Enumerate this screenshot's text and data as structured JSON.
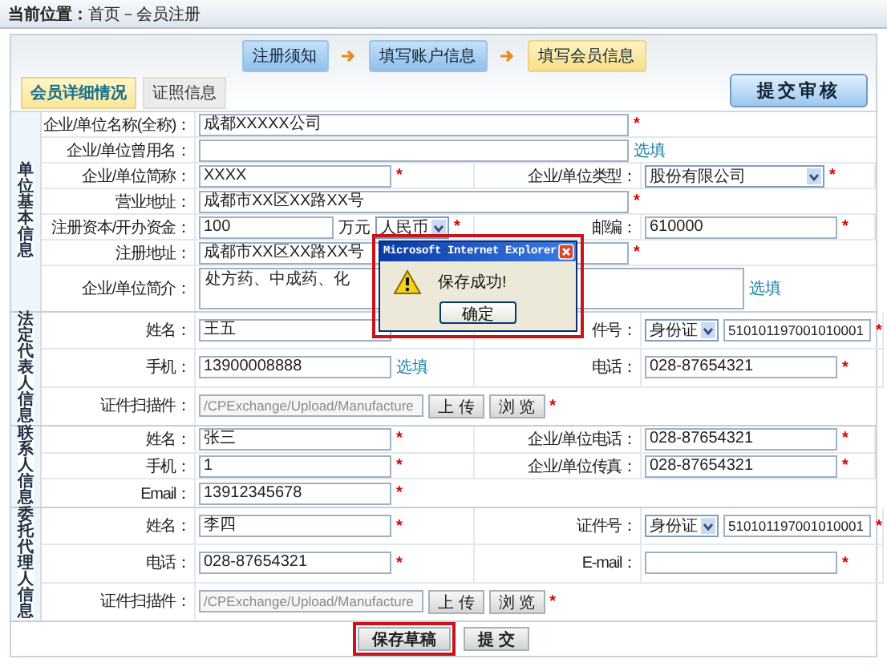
{
  "breadcrumb": {
    "label": "当前位置：",
    "path": "首页－会员注册"
  },
  "steps": [
    {
      "label": "注册须知",
      "selected": false
    },
    {
      "label": "填写账户信息",
      "selected": false
    },
    {
      "label": "填写会员信息",
      "selected": true
    }
  ],
  "tabs": [
    {
      "label": "会员详细情况",
      "selected": true
    },
    {
      "label": "证照信息",
      "selected": false
    }
  ],
  "review_button": {
    "label": "提交审核"
  },
  "sections": [
    {
      "title": "单位基本信息",
      "rows": [
        {
          "groups": [
            {
              "label": "企业/单位名称(全称)：",
              "items": [
                {
                  "kind": "long-input",
                  "value": "成都XXXXX公司"
                },
                {
                  "kind": "required",
                  "text": "*"
                }
              ]
            }
          ]
        },
        {
          "groups": [
            {
              "label": "企业/单位曾用名：",
              "items": [
                {
                  "kind": "long-input"
                },
                {
                  "kind": "optional",
                  "text": "选填"
                }
              ]
            }
          ]
        },
        {
          "groups": [
            {
              "label": "企业/单位简称：",
              "items": [
                {
                  "kind": "input",
                  "value": "XXXX"
                },
                {
                  "kind": "required",
                  "text": "*"
                }
              ]
            },
            {
              "label": "企业/单位类型：",
              "items": [
                {
                  "kind": "wide-select",
                  "value": "股份有限公司"
                },
                {
                  "kind": "required",
                  "text": "*"
                }
              ]
            }
          ]
        },
        {
          "groups": [
            {
              "label": "营业地址：",
              "items": [
                {
                  "kind": "long-input",
                  "value": "成都市XX区XX路XX号"
                },
                {
                  "kind": "required",
                  "text": "*"
                }
              ]
            }
          ]
        },
        {
          "groups": [
            {
              "label": "注册资本/开办资金：",
              "items": [
                {
                  "kind": "short-input",
                  "value": "100"
                },
                {
                  "kind": "unit",
                  "text": "万元"
                },
                {
                  "kind": "select",
                  "value": "人民币"
                },
                {
                  "kind": "required",
                  "text": "*"
                }
              ]
            },
            {
              "label": "邮编：",
              "items": [
                {
                  "kind": "input",
                  "value": "610000"
                },
                {
                  "kind": "required",
                  "text": "*"
                }
              ]
            }
          ]
        },
        {
          "groups": [
            {
              "label": "注册地址：",
              "items": [
                {
                  "kind": "long-input",
                  "value": "成都市XX区XX路XX号"
                },
                {
                  "kind": "required",
                  "text": "*"
                }
              ]
            }
          ]
        },
        {
          "groups": [
            {
              "label": "企业/单位简介：",
              "items": [
                {
                  "kind": "textarea",
                  "value": "处方药、中成药、化"
                },
                {
                  "kind": "optional",
                  "text": "选填"
                }
              ]
            }
          ]
        }
      ]
    },
    {
      "title": "法定代表人信息",
      "rows": [
        {
          "groups": [
            {
              "label": "姓名：",
              "items": [
                {
                  "kind": "input",
                  "value": "王五"
                }
              ]
            },
            {
              "label": "件号：",
              "items": [
                {
                  "kind": "select",
                  "value": "身份证"
                },
                {
                  "kind": "id-input",
                  "value": "510101197001010001"
                },
                {
                  "kind": "required",
                  "text": "*"
                }
              ]
            }
          ]
        },
        {
          "groups": [
            {
              "label": "手机：",
              "items": [
                {
                  "kind": "input",
                  "value": "13900008888"
                },
                {
                  "kind": "optional",
                  "text": "选填"
                }
              ]
            },
            {
              "label": "电话：",
              "items": [
                {
                  "kind": "input",
                  "value": "028-87654321"
                },
                {
                  "kind": "required",
                  "text": "*"
                }
              ]
            }
          ]
        },
        {
          "groups": [
            {
              "label": "证件扫描件：",
              "items": [
                {
                  "kind": "file-input",
                  "value": "/CPExchange/Upload/Manufacture",
                  "disabled": true
                },
                {
                  "kind": "button",
                  "text": "上 传"
                },
                {
                  "kind": "button",
                  "text": "浏 览"
                },
                {
                  "kind": "required",
                  "text": "*"
                }
              ]
            }
          ]
        }
      ]
    },
    {
      "title": "联系人信息",
      "rows": [
        {
          "groups": [
            {
              "label": "姓名：",
              "items": [
                {
                  "kind": "input",
                  "value": "张三"
                },
                {
                  "kind": "required",
                  "text": "*"
                }
              ]
            },
            {
              "label": "企业/单位电话：",
              "items": [
                {
                  "kind": "input",
                  "value": "028-87654321"
                },
                {
                  "kind": "required",
                  "text": "*"
                }
              ]
            }
          ]
        },
        {
          "groups": [
            {
              "label": "手机：",
              "items": [
                {
                  "kind": "input",
                  "value": "1"
                },
                {
                  "kind": "required",
                  "text": "*"
                }
              ]
            },
            {
              "label": "企业/单位传真：",
              "items": [
                {
                  "kind": "input",
                  "value": "028-87654321"
                },
                {
                  "kind": "required",
                  "text": "*"
                }
              ]
            }
          ]
        },
        {
          "groups": [
            {
              "label": "Email：",
              "items": [
                {
                  "kind": "input",
                  "value": "13912345678"
                },
                {
                  "kind": "required",
                  "text": "*"
                }
              ]
            }
          ]
        }
      ]
    },
    {
      "title": "委托代理人信息",
      "rows": [
        {
          "groups": [
            {
              "label": "姓名：",
              "items": [
                {
                  "kind": "input",
                  "value": "李四"
                },
                {
                  "kind": "required",
                  "text": "*"
                }
              ]
            },
            {
              "label": "证件号：",
              "items": [
                {
                  "kind": "select",
                  "value": "身份证"
                },
                {
                  "kind": "id-input",
                  "value": "510101197001010001"
                },
                {
                  "kind": "required",
                  "text": "*"
                }
              ]
            }
          ]
        },
        {
          "groups": [
            {
              "label": "电话：",
              "items": [
                {
                  "kind": "input",
                  "value": "028-87654321"
                },
                {
                  "kind": "required",
                  "text": "*"
                }
              ]
            },
            {
              "label": "E-mail：",
              "items": [
                {
                  "kind": "input"
                },
                {
                  "kind": "required",
                  "text": "*"
                }
              ]
            }
          ]
        },
        {
          "groups": [
            {
              "label": "证件扫描件：",
              "items": [
                {
                  "kind": "file-input",
                  "value": "/CPExchange/Upload/Manufacture",
                  "disabled": true
                },
                {
                  "kind": "button",
                  "text": "上 传"
                },
                {
                  "kind": "button",
                  "text": "浏 览"
                },
                {
                  "kind": "required",
                  "text": "*"
                }
              ]
            }
          ]
        }
      ]
    }
  ],
  "actions": [
    {
      "label": "保存草稿",
      "highlighted": true
    },
    {
      "label": "提 交",
      "highlighted": false
    }
  ],
  "dialog": {
    "title": "Microsoft Internet Explorer",
    "message": "保存成功!",
    "ok_button": "确定",
    "highlighted": true
  }
}
